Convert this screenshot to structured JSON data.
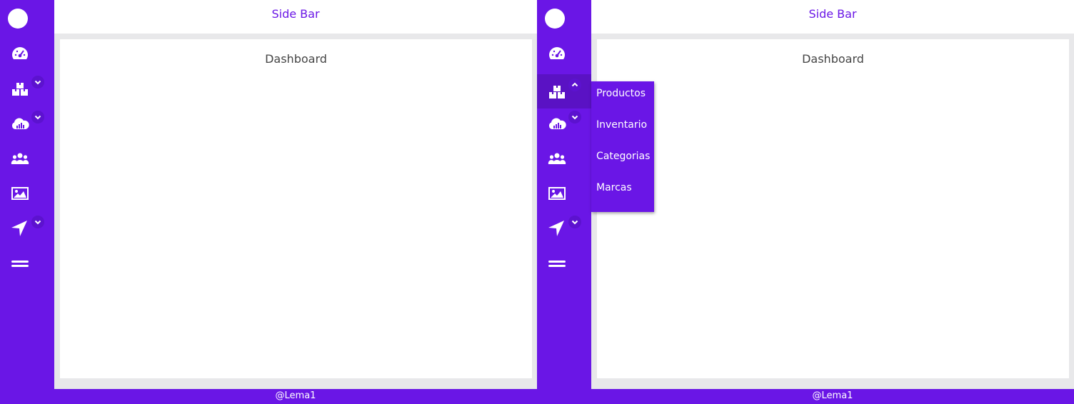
{
  "colors": {
    "accent": "#6a16e6",
    "active": "#5a12c4",
    "content_bg": "#e8e8ea",
    "text_dark": "#444444"
  },
  "topbar": {
    "title": "Side Bar"
  },
  "main": {
    "title": "Dashboard"
  },
  "footer": {
    "text": "@Lema1"
  },
  "sidebar": {
    "items": [
      {
        "icon": "gauge-icon",
        "has_submenu": false
      },
      {
        "icon": "boxes-icon",
        "has_submenu": true
      },
      {
        "icon": "cloud-chart-icon",
        "has_submenu": true
      },
      {
        "icon": "users-icon",
        "has_submenu": false
      },
      {
        "icon": "image-icon",
        "has_submenu": false
      },
      {
        "icon": "location-arrow-icon",
        "has_submenu": true
      },
      {
        "icon": "menu-icon",
        "has_submenu": false
      }
    ]
  },
  "dropdown": {
    "items": [
      "Productos",
      "Inventario",
      "Categorias",
      "Marcas"
    ]
  }
}
